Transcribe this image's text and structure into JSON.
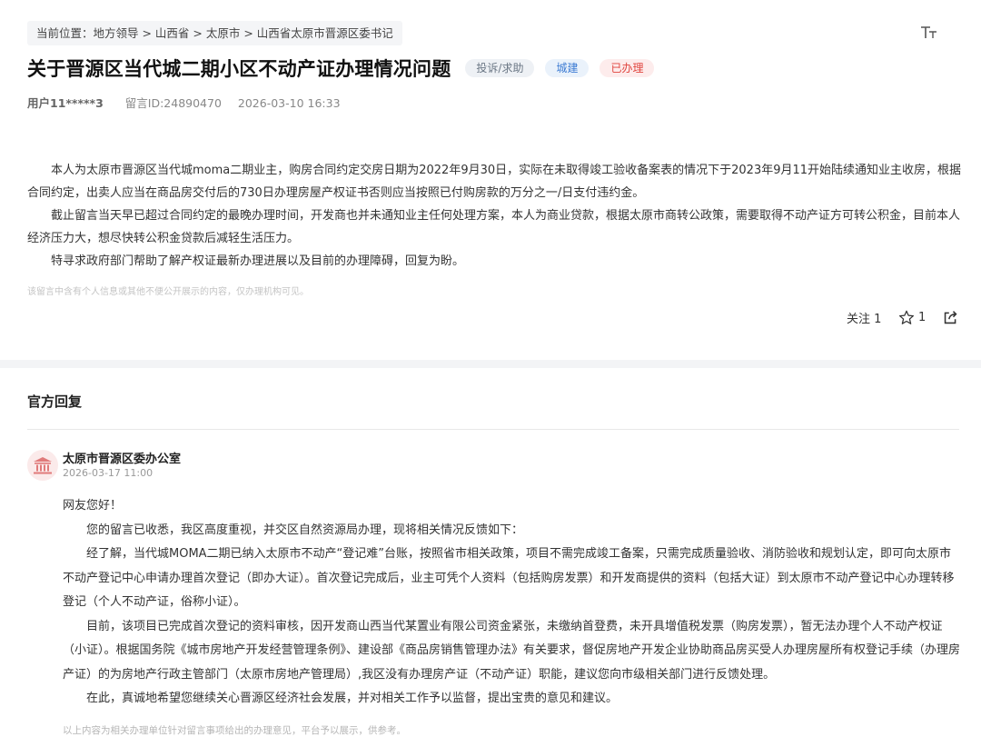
{
  "breadcrumb": "当前位置：地方领导 > 山西省 > 太原市 > 山西省太原市晋源区委书记",
  "font_size_icon": "font-size-icon",
  "title": "关于晋源区当代城二期小区不动产证办理情况问题",
  "tags": [
    {
      "label": "投诉/求助",
      "color": "#6b7785"
    },
    {
      "label": "城建",
      "color": "#3c7bd3"
    },
    {
      "label": "已办理",
      "color": "#e0443e"
    }
  ],
  "meta": {
    "user": "用户11*****3",
    "message_id": "留言ID:24890470",
    "datetime": "2026-03-10 16:33"
  },
  "content": [
    "本人为太原市晋源区当代城moma二期业主，购房合同约定交房日期为2022年9月30日，实际在未取得竣工验收备案表的情况下于2023年9月11开始陆续通知业主收房，根据合同约定，出卖人应当在商品房交付后的730日办理房屋产权证书否则应当按照已付购房款的万分之一/日支付违约金。",
    "截止留言当天早已超过合同约定的最晚办理时间，开发商也并未通知业主任何处理方案，本人为商业贷款，根据太原市商转公政策，需要取得不动产证方可转公积金，目前本人经济压力大，想尽快转公积金贷款后减轻生活压力。",
    "特寻求政府部门帮助了解产权证最新办理进展以及目前的办理障碍，回复为盼。"
  ],
  "privacy_note": "该留言中含有个人信息或其他不便公开展示的内容，仅办理机构可见。",
  "actions": {
    "follow_label": "关注 1",
    "star_count": "1"
  },
  "reply": {
    "heading": "官方回复",
    "org": "太原市晋源区委办公室",
    "time": "2026-03-17 11:00",
    "greeting": "网友您好！",
    "paragraphs": [
      "您的留言已收悉，我区高度重视，并交区自然资源局办理，现将相关情况反馈如下：",
      "经了解，当代城MOMA二期已纳入太原市不动产“登记难”台账，按照省市相关政策，项目不需完成竣工备案，只需完成质量验收、消防验收和规划认定，即可向太原市不动产登记中心申请办理首次登记（即办大证）。首次登记完成后，业主可凭个人资料（包括购房发票）和开发商提供的资料（包括大证）到太原市不动产登记中心办理转移登记（个人不动产证，俗称小证）。",
      "目前，该项目已完成首次登记的资料审核，因开发商山西当代某置业有限公司资金紧张，未缴纳首登费，未开具增值税发票（购房发票），暂无法办理个人不动产权证（小证）。根据国务院《城市房地产开发经营管理条例》、建设部《商品房销售管理办法》有关要求，督促房地产开发企业协助商品房买受人办理房屋所有权登记手续（办理房产证）的为房地产行政主管部门（太原市房地产管理局）,我区没有办理房产证（不动产证）职能，建议您向市级相关部门进行反馈处理。",
      "在此，真诚地希望您继续关心晋源区经济社会发展，并对相关工作予以监督，提出宝贵的意见和建议。"
    ],
    "footnote": "以上内容为相关办理单位针对留言事项给出的办理意见，平台予以展示，供参考。"
  }
}
